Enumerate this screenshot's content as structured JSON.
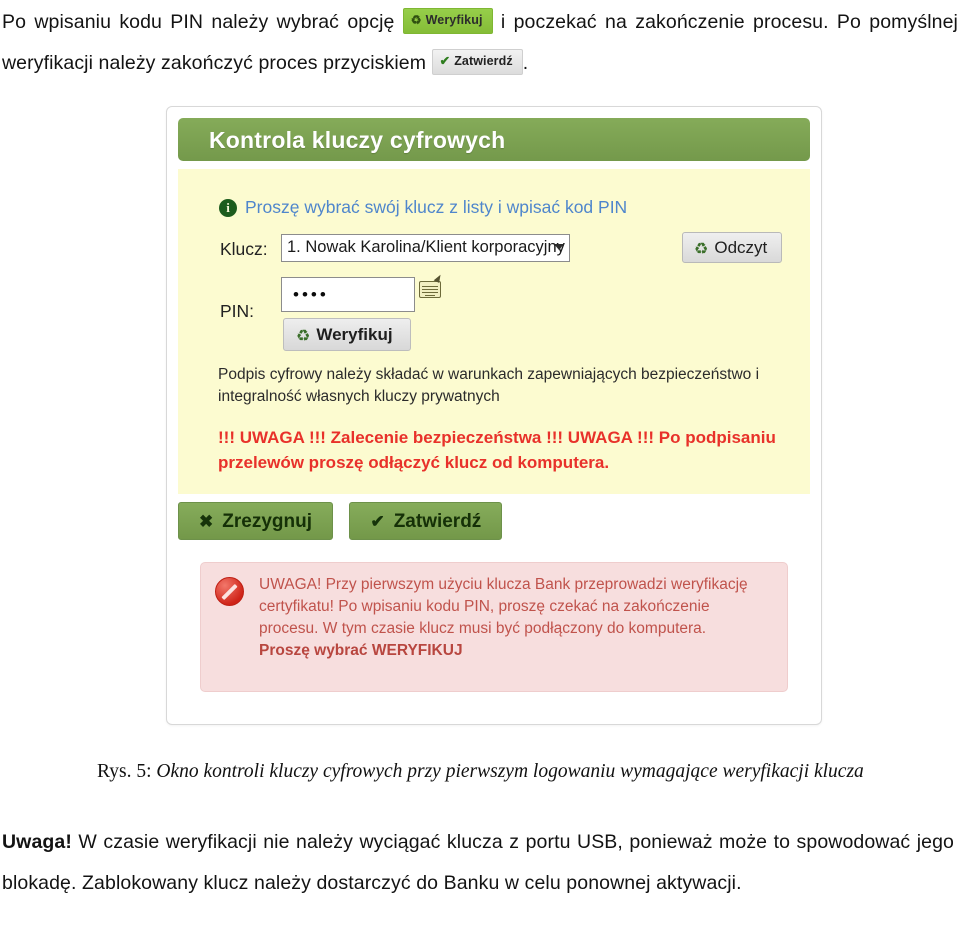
{
  "document": {
    "intro_paragraph": {
      "part1": "Po wpisaniu kodu PIN należy wybrać opcję",
      "inline_button_1": {
        "label": "Weryfikuj",
        "icon": "refresh-icon",
        "color": "#8cc63f"
      },
      "part2": "i poczekać na zakończenie procesu. Po pomyślnej weryfikacji należy zakończyć proces przyciskiem",
      "inline_button_2": {
        "label": "Zatwierdź",
        "icon": "check-icon",
        "color": "#e6e6e6"
      },
      "part3": "."
    },
    "figure_caption": {
      "number": "Rys. 5:",
      "title": "Okno kontroli kluczy cyfrowych przy pierwszym logowaniu wymagające weryfikacji klucza"
    },
    "closing_paragraph": {
      "lead": "Uwaga!",
      "body": " W czasie weryfikacji nie należy wyciągać klucza z portu USB, ponieważ może to spowodować jego blokadę. Zablokowany klucz należy dostarczyć do Banku w celu ponownej aktywacji."
    }
  },
  "figure": {
    "app_header": {
      "title": "Kontrola kluczy cyfrowych",
      "background_color": "#7da352",
      "text_color": "#ffffff"
    },
    "panel": {
      "background_color": "#fcfbd0",
      "info": {
        "icon": "info-icon",
        "text": "Proszę wybrać swój klucz z listy i wpisać kod PIN",
        "text_color": "#4f86cc"
      },
      "key_field": {
        "label": "Klucz:",
        "selected_option": "1. Nowak Karolina/Klient korporacyjny",
        "caret_icon": "chevron-down-icon"
      },
      "read_button": {
        "label": "Odczyt",
        "icon": "refresh-icon"
      },
      "pin_field": {
        "label": "PIN:",
        "value": "••••",
        "keyboard_icon": "virtual-keyboard-icon"
      },
      "verify_button": {
        "label": "Weryfikuj",
        "icon": "refresh-icon"
      },
      "note_text": "Podpis cyfrowy należy składać w warunkach zapewniających bezpieczeństwo i integralność własnych kluczy prywatnych",
      "warning_text": "!!! UWAGA !!! Zalecenie bezpieczeństwa !!! UWAGA !!! Po podpisaniu przelewów proszę odłączyć klucz od komputera.",
      "warning_color": "#e8312a"
    },
    "actions": {
      "cancel_button": {
        "label": "Zrezygnuj",
        "icon": "cross-icon",
        "glyph": "✖"
      },
      "confirm_button": {
        "label": "Zatwierdź",
        "icon": "check-icon",
        "glyph": "✔"
      },
      "background_color": "#7da352"
    },
    "alert": {
      "icon": "prohibition-icon",
      "background_color": "#f7dede",
      "text_color": "#c0534c",
      "body": "UWAGA! Przy pierwszym użyciu klucza Bank przeprowadzi weryfikację certyfikatu! Po wpisaniu kodu PIN, proszę czekać na zakończenie procesu. W tym czasie klucz musi być podłączony do komputera.",
      "emphasis": "Proszę wybrać WERYFIKUJ"
    }
  }
}
